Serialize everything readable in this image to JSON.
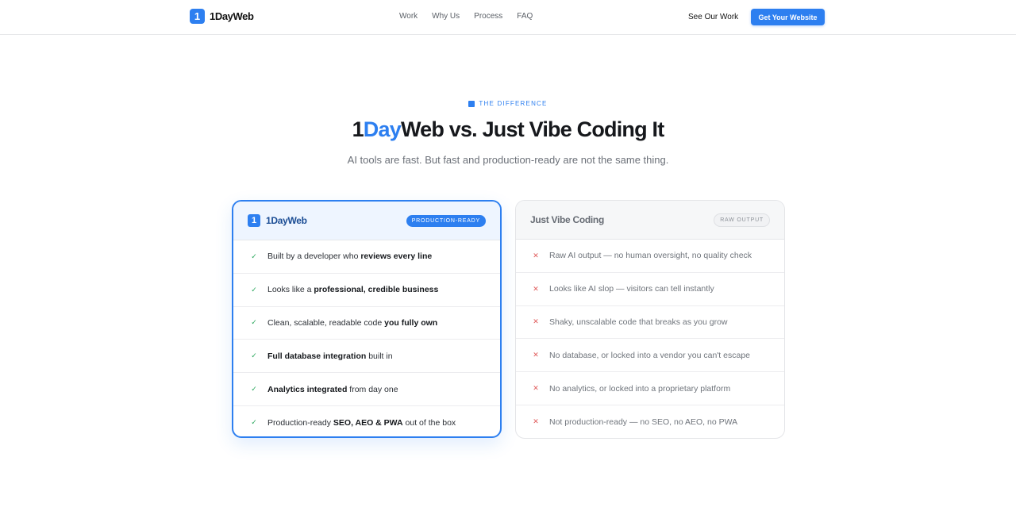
{
  "nav": {
    "logo_mark": "1",
    "logo_text": "1DayWeb",
    "links": [
      "Work",
      "Why Us",
      "Process",
      "FAQ"
    ],
    "see_work": "See Our Work",
    "cta": "Get Your Website"
  },
  "header": {
    "eyebrow": "THE DIFFERENCE",
    "title_pre": "1",
    "title_accent": "Day",
    "title_post": "Web vs. Just Vibe Coding It",
    "subtitle": "AI tools are fast. But fast and production-ready are not the same thing."
  },
  "left_card": {
    "mark": "1",
    "title": "1DayWeb",
    "badge": "PRODUCTION-READY",
    "rows": [
      {
        "a": "Built by a developer who ",
        "b": "reviews every line",
        "c": ""
      },
      {
        "a": "Looks like a ",
        "b": "professional, credible business",
        "c": ""
      },
      {
        "a": "Clean, scalable, readable code ",
        "b": "you fully own",
        "c": ""
      },
      {
        "a": "",
        "b": "Full database integration",
        "c": " built in"
      },
      {
        "a": "",
        "b": "Analytics integrated",
        "c": " from day one"
      },
      {
        "a": "Production-ready ",
        "b": "SEO, AEO & PWA",
        "c": " out of the box"
      }
    ]
  },
  "right_card": {
    "title": "Just Vibe Coding",
    "badge": "RAW OUTPUT",
    "rows": [
      "Raw AI output — no human oversight, no quality check",
      "Looks like AI slop — visitors can tell instantly",
      "Shaky, unscalable code that breaks as you grow",
      "No database, or locked into a vendor you can't escape",
      "No analytics, or locked into a proprietary platform",
      "Not production-ready — no SEO, no AEO, no PWA"
    ]
  },
  "icons": {
    "check": "check-icon",
    "cross": "cross-icon"
  },
  "colors": {
    "accent": "#2d7ff0",
    "check": "#27a65a",
    "cross": "#e05a5a"
  }
}
